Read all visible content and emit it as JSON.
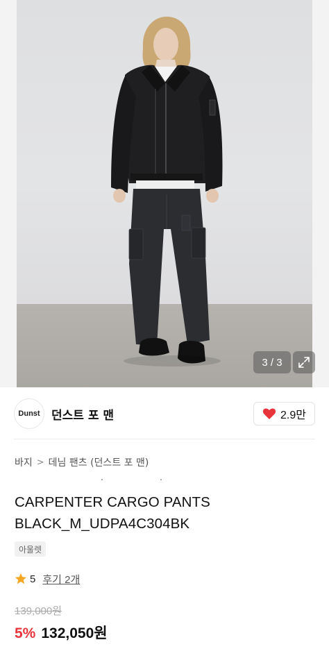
{
  "gallery": {
    "counter": "3 / 3",
    "expand_icon": "expand-diagonal-icon"
  },
  "brand": {
    "logo_text": "Dunst",
    "name": "던스트 포 맨",
    "likes": "2.9만",
    "heart_color": "#e8343b"
  },
  "breadcrumb": {
    "items": [
      "바지",
      "데님 팬츠 (던스트 포 맨)"
    ],
    "separator": ">"
  },
  "product": {
    "title": "CARPENTER CARGO PANTS BLACK_M_UDPA4C304BK",
    "tag": "아울렛",
    "rating": "5",
    "review_link": "후기 2개",
    "original_price": "139,000원",
    "discount": "5%",
    "sale_price": "132,050원",
    "discount_color": "#e8343b",
    "star_color": "#f5a623"
  }
}
